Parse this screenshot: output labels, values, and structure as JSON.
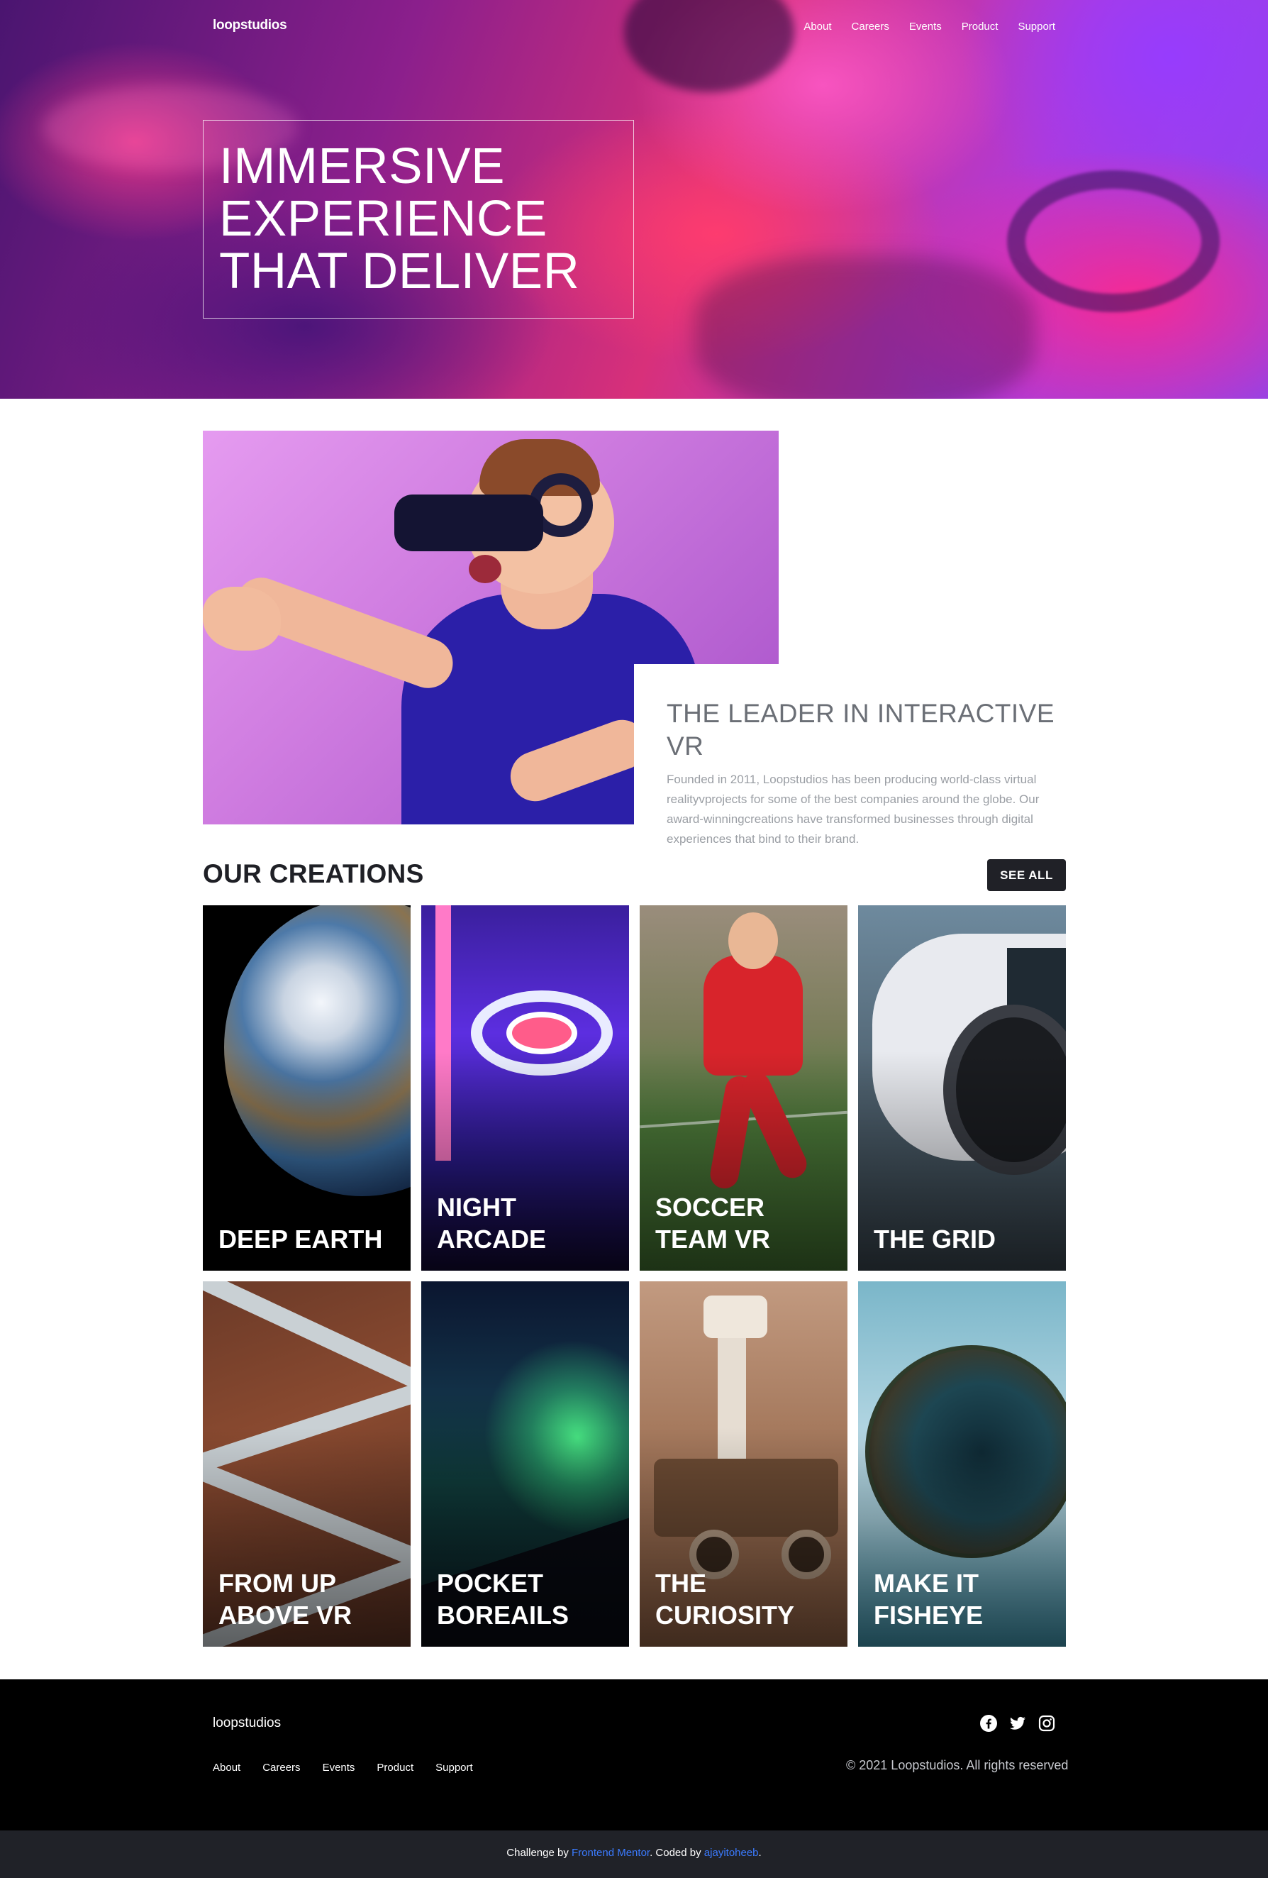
{
  "header": {
    "logo": "loopstudios",
    "nav": [
      "About",
      "Careers",
      "Events",
      "Product",
      "Support"
    ]
  },
  "hero": {
    "title_lines": [
      "IMMERSIVE",
      "EXPERIENCE",
      "THAT DELIVER"
    ]
  },
  "intro": {
    "title": "THE LEADER IN INTERACTIVE VR",
    "body": "Founded in 2011, Loopstudios has been producing world-class virtual realityvprojects for some of the best companies around the globe. Our award-winningcreations have transformed businesses through digital experiences that bind to their brand."
  },
  "creations": {
    "title": "OUR CREATIONS",
    "see_all": "SEE ALL",
    "items": [
      {
        "label": "DEEP EARTH"
      },
      {
        "label": "NIGHT ARCADE"
      },
      {
        "label": "SOCCER TEAM VR"
      },
      {
        "label": "THE GRID"
      },
      {
        "label": "FROM UP ABOVE VR"
      },
      {
        "label": "POCKET BOREAILS"
      },
      {
        "label": "THE CURIOSITY"
      },
      {
        "label": "MAKE IT FISHEYE"
      }
    ]
  },
  "footer": {
    "logo": "loopstudios",
    "nav": [
      "About",
      "Careers",
      "Events",
      "Product",
      "Support"
    ],
    "social": [
      "facebook-icon",
      "twitter-icon",
      "instagram-icon"
    ],
    "copyright": "© 2021 Loopstudios. All rights reserved"
  },
  "attribution": {
    "prefix": "Challenge by ",
    "link1": "Frontend Mentor",
    "middle": ". Coded by ",
    "link2": "ajayitoheeb",
    "suffix": "."
  },
  "colors": {
    "accent_link": "#3b7bff",
    "dark_button": "#202127",
    "footer_bg": "#000000",
    "attribution_bg": "#202228"
  }
}
